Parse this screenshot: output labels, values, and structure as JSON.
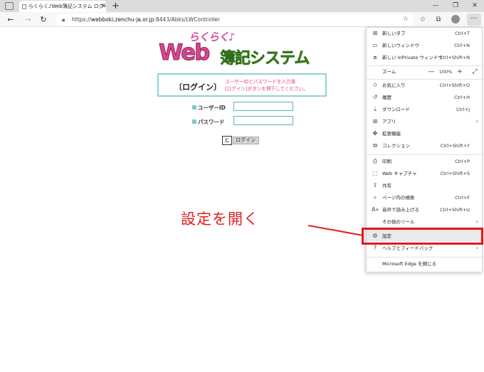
{
  "browser": {
    "tab_title": "らくらく♪Web簿記システム ログイン画面",
    "url_prefix": "https://",
    "url_host": "webboki.zenchu-ja.or.jp",
    "url_rest": ":8443/Abks/LWController"
  },
  "page": {
    "logo_top": "らくらく♪",
    "logo_web": "Web",
    "logo_system": "簿記システム",
    "login_heading": "〔ログイン〕",
    "login_msg_1": "ユーザーIDとパスワードを入力後",
    "login_msg_2": "[ログイン]ボタンを押下してください。",
    "userid_label": "ユーザーID",
    "password_label": "パスワード",
    "userid_value": "",
    "password_value": "",
    "login_button": "ログイン"
  },
  "annotation": {
    "text": "設定を開く",
    "color": "#e02020"
  },
  "menu": {
    "new_tab": "新しいタブ",
    "new_tab_sc": "Ctrl+T",
    "new_window": "新しいウィンドウ",
    "new_window_sc": "Ctrl+N",
    "inprivate": "新しい InPrivate ウィンドウ",
    "inprivate_sc": "Ctrl+Shift+N",
    "zoom": "ズーム",
    "zoom_value": "100%",
    "favorites": "お気に入り",
    "favorites_sc": "Ctrl+Shift+O",
    "history": "履歴",
    "history_sc": "Ctrl+H",
    "downloads": "ダウンロード",
    "downloads_sc": "Ctrl+J",
    "apps": "アプリ",
    "extensions": "拡張機能",
    "collections": "コレクション",
    "collections_sc": "Ctrl+Shift+Y",
    "print": "印刷",
    "print_sc": "Ctrl+P",
    "web_capture": "Web キャプチャ",
    "web_capture_sc": "Ctrl+Shift+S",
    "share": "共有",
    "find": "ページ内の検索",
    "find_sc": "Ctrl+F",
    "read_aloud": "音声で読み上げる",
    "read_aloud_sc": "Ctrl+Shift+U",
    "more_tools": "その他のツール",
    "settings": "設定",
    "help": "ヘルプとフィードバック",
    "close": "Microsoft Edge を閉じる"
  }
}
